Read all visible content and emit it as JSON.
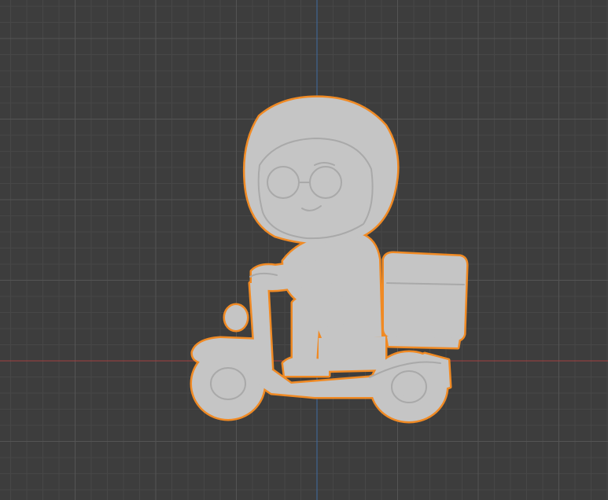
{
  "viewport": {
    "background_color": "#3d3d3d",
    "grid_minor_color": "#474747",
    "grid_major_color": "#545454",
    "x_axis_color": "#a1403f",
    "y_axis_color": "#3f6aa1",
    "selection_outline_color": "#f08a24",
    "model_color": "#c5c5c5",
    "model_shadow_color": "#a9a9a9"
  },
  "scene": {
    "selected_object": "rider-on-scooter-model"
  }
}
